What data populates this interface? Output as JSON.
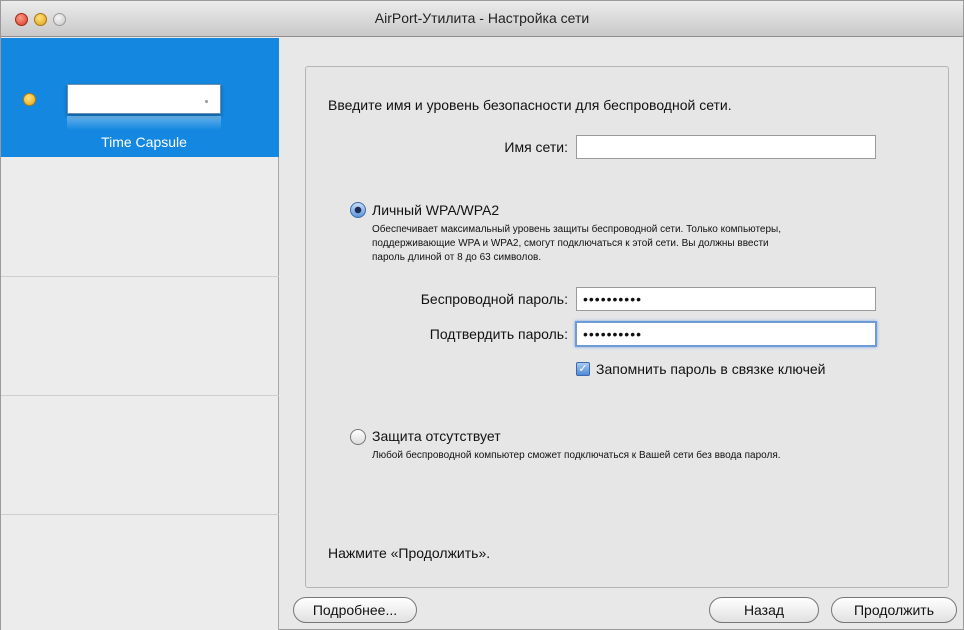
{
  "window": {
    "title": "AirPort-Утилита - Настройка сети"
  },
  "sidebar": {
    "device_label": "Time Capsule"
  },
  "main": {
    "intro": "Введите имя и уровень безопасности для беспроводной сети.",
    "network_name_label": "Имя сети:",
    "network_name_value": "",
    "wpa": {
      "title": "Личный WPA/WPA2",
      "description_lines": [
        "Обеспечивает максимальный уровень защиты беспроводной сети. Только компьютеры,",
        "поддерживающие WPA и WPA2, смогут подключаться к этой сети. Вы должны ввести",
        "пароль длиной от 8 до 63 символов."
      ],
      "selected": true
    },
    "password_label": "Беспроводной пароль:",
    "password_value": "••••••••••",
    "confirm_label": "Подтвердить пароль:",
    "confirm_value": "••••••••••",
    "keychain_label": "Запомнить пароль в связке ключей",
    "keychain_checked": true,
    "none": {
      "title": "Защита отсутствует",
      "description": "Любой беспроводной компьютер сможет подключаться к Вашей сети без ввода пароля.",
      "selected": false
    },
    "footer": "Нажмите «Продолжить»."
  },
  "buttons": {
    "more": "Подробнее...",
    "back": "Назад",
    "continue": "Продолжить"
  }
}
